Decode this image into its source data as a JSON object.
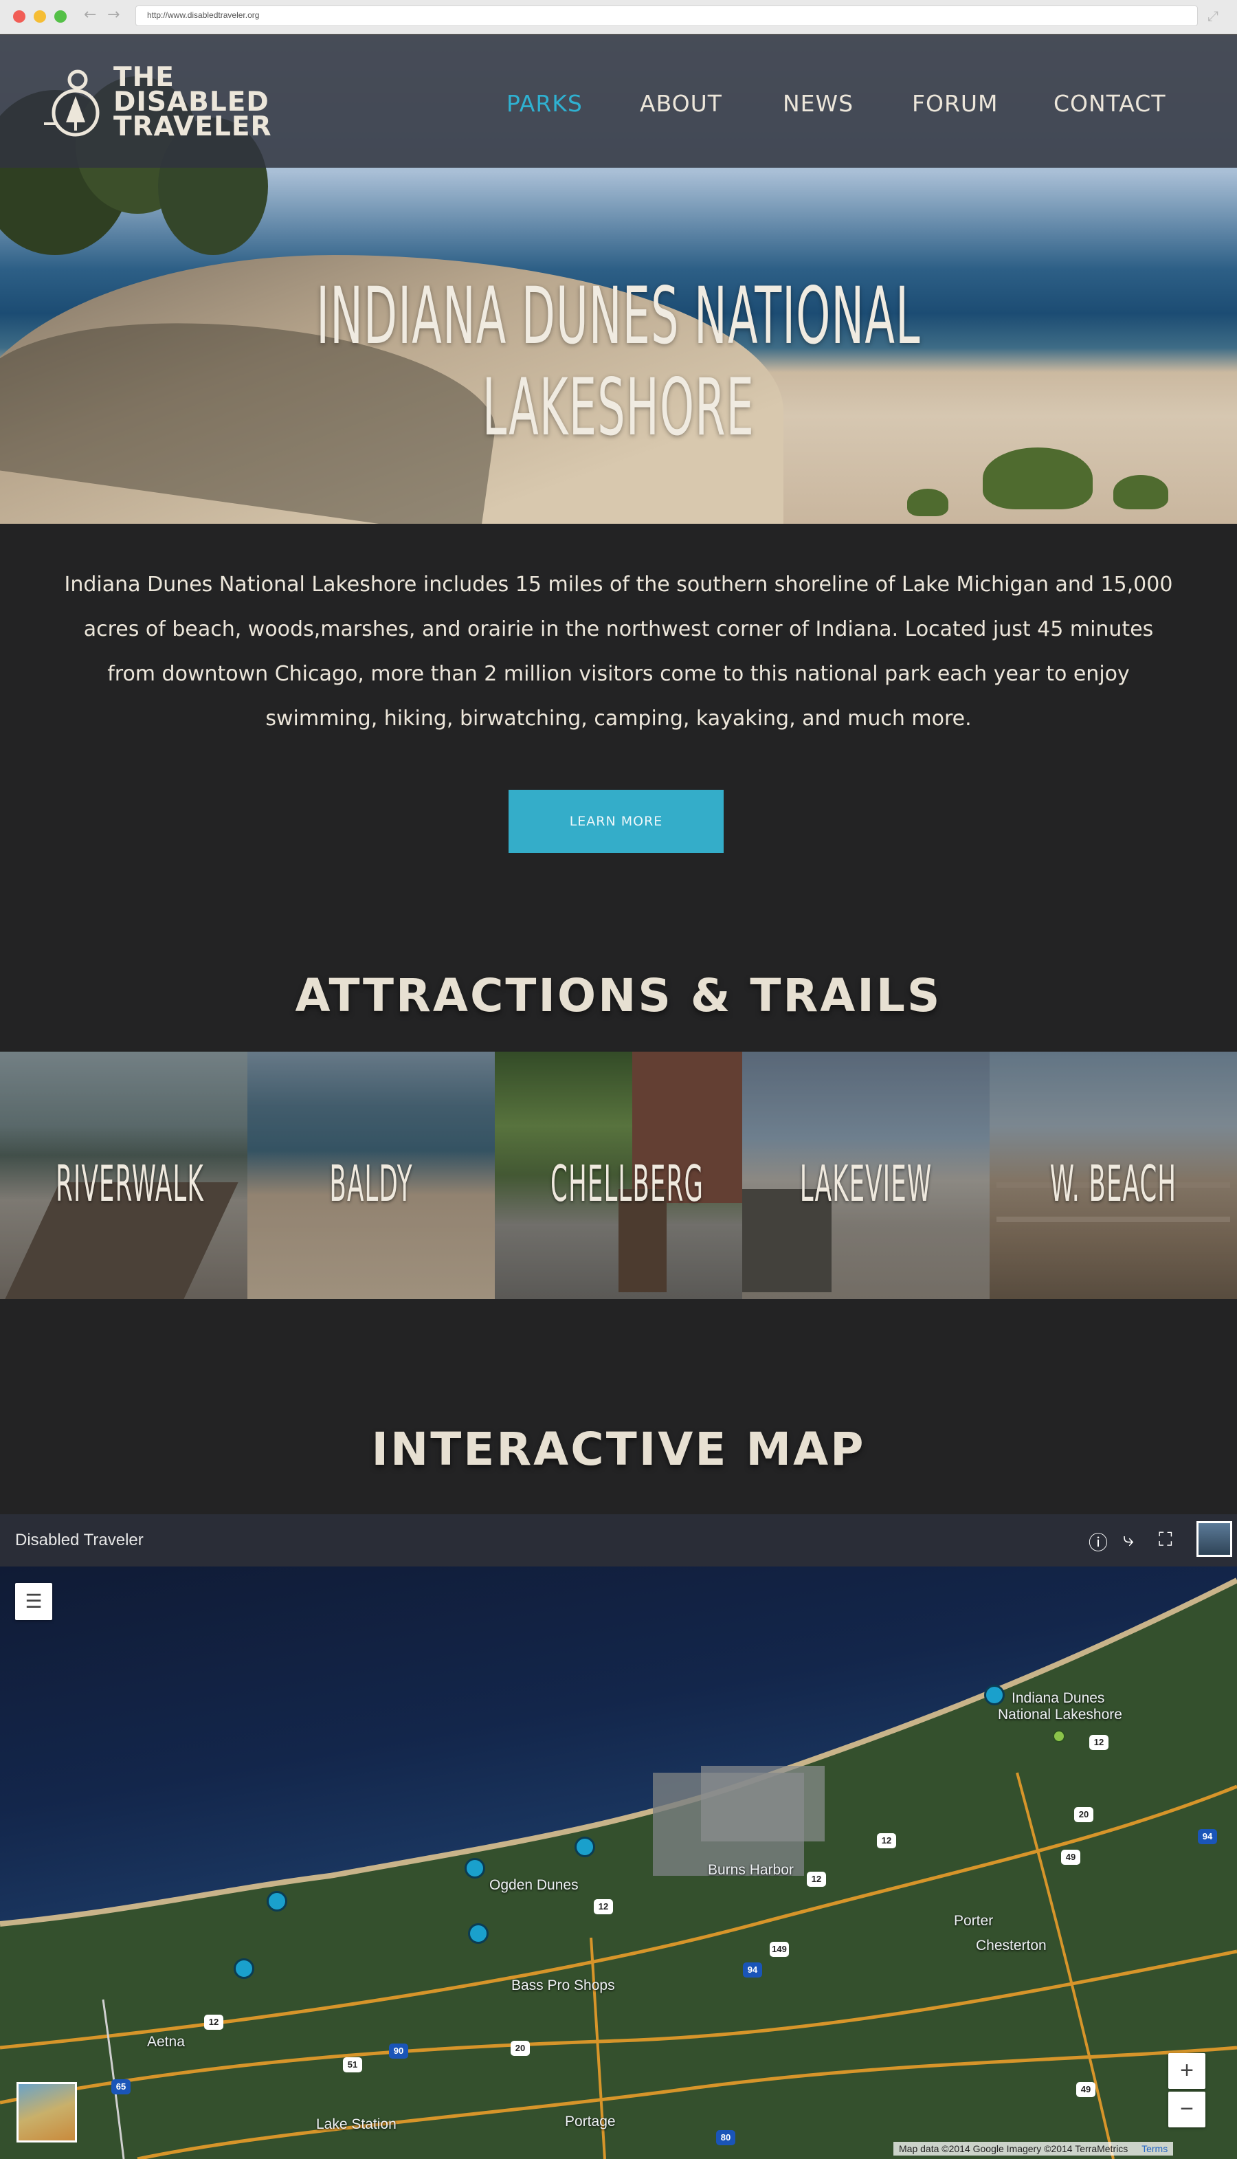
{
  "browser": {
    "url": "http://www.disabledtraveler.org"
  },
  "brand": {
    "name_lines": [
      "THE",
      "DISABLED",
      "TRAVELER"
    ]
  },
  "nav": {
    "items": [
      {
        "label": "PARKS",
        "active": true
      },
      {
        "label": "ABOUT"
      },
      {
        "label": "NEWS"
      },
      {
        "label": "FORUM"
      },
      {
        "label": "CONTACT"
      }
    ]
  },
  "hero": {
    "title": "INDIANA DUNES NATIONAL LAKESHORE"
  },
  "intro": {
    "text": "Indiana Dunes National Lakeshore includes 15 miles of the southern shoreline of Lake Michigan and 15,000 acres of beach, woods,marshes, and orairie in the northwest corner of Indiana.  Located just 45 minutes from downtown Chicago, more than 2 million visitors come to this national park each year to enjoy swimming, hiking, birwatching, camping, kayaking, and much more.",
    "button_label": "LEARN MORE"
  },
  "attractions": {
    "title": "ATTRACTIONS & TRAILS",
    "tiles": [
      {
        "label": "RIVERWALK"
      },
      {
        "label": "BALDY"
      },
      {
        "label": "CHELLBERG"
      },
      {
        "label": "LAKEVIEW"
      },
      {
        "label": "W. BEACH"
      }
    ]
  },
  "map_section": {
    "title": "INTERACTIVE MAP",
    "map_title": "Disabled Traveler",
    "places": {
      "lakeshore_line1": "Indiana Dunes",
      "lakeshore_line2": "National Lakeshore",
      "ogden": "Ogden Dunes",
      "burns": "Burns Harbor",
      "porter": "Porter",
      "chesterton": "Chesterton",
      "bass": "Bass Pro Shops",
      "aetna": "Aetna",
      "lake_station": "Lake Station",
      "portage": "Portage"
    },
    "routes": {
      "r12a": "12",
      "r12b": "12",
      "r12c": "12",
      "r12d": "12",
      "r12e": "12",
      "r20a": "20",
      "r20b": "20",
      "r49a": "49",
      "r49b": "49",
      "r94a": "94",
      "r94b": "94",
      "r149": "149",
      "r51": "51",
      "r90": "90",
      "r65": "65",
      "r80": "80"
    },
    "zoom_in": "+",
    "zoom_out": "−",
    "credit": "Map data ©2014 Google Imagery ©2014 TerraMetrics",
    "terms": "Terms"
  },
  "colors": {
    "accent": "#2fb1d1",
    "button": "#34adc9",
    "background": "#232324",
    "text": "#ece6da"
  },
  "icons": [
    "back-arrow-icon",
    "forward-arrow-icon",
    "expand-icon",
    "info-icon",
    "share-icon",
    "fullscreen-icon",
    "layers-list-icon",
    "map-pin-icon"
  ]
}
